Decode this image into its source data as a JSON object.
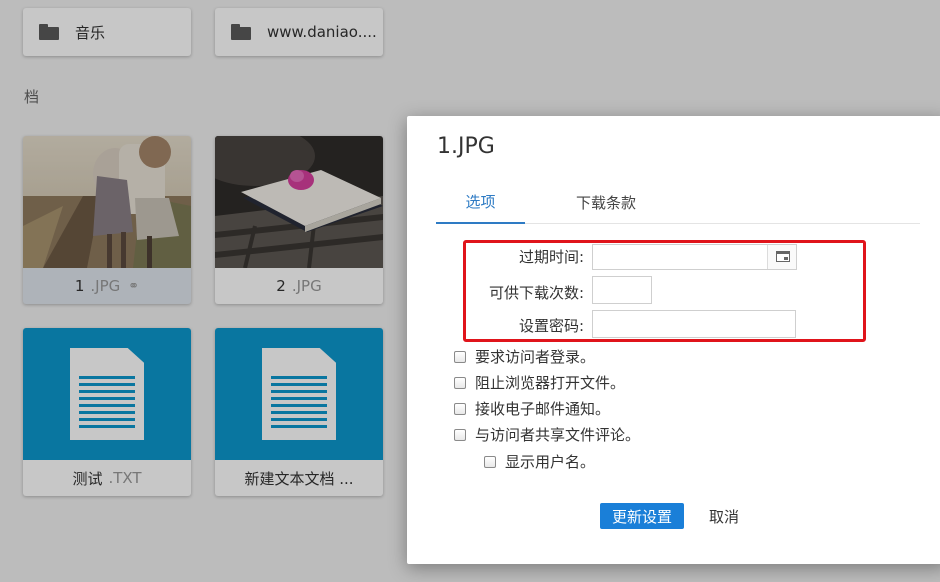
{
  "folders": [
    {
      "name": "音乐",
      "icon": "folder-icon"
    },
    {
      "name": "www.daniao....",
      "icon": "folder-icon"
    }
  ],
  "section_label": "档",
  "files": [
    {
      "name": "1",
      "ext": ".JPG",
      "link_glyph": "⚭"
    },
    {
      "name": "2",
      "ext": ".JPG"
    },
    {
      "name": "测试",
      "ext": ".TXT"
    },
    {
      "name": "新建文本文档 ..."
    }
  ],
  "dialog": {
    "title": "1.JPG",
    "tabs": [
      {
        "label": "选项",
        "active": true
      },
      {
        "label": "下载条款",
        "active": false
      }
    ],
    "fields": {
      "expiry": {
        "label": "过期时间:",
        "value": "",
        "icon": "calendar-icon"
      },
      "download_count": {
        "label": "可供下载次数:",
        "value": ""
      },
      "password": {
        "label": "设置密码:",
        "value": ""
      }
    },
    "checkboxes": [
      {
        "label": "要求访问者登录。",
        "checked": false
      },
      {
        "label": "阻止浏览器打开文件。",
        "checked": false
      },
      {
        "label": "接收电子邮件通知。",
        "checked": false
      },
      {
        "label": "与访问者共享文件评论。",
        "checked": false
      },
      {
        "label": "显示用户名。",
        "checked": false
      }
    ],
    "buttons": {
      "update": "更新设置",
      "cancel": "取消"
    }
  },
  "colors": {
    "accent": "#2e7bc4",
    "primary_button": "#1a7fd8",
    "highlight_box": "#e0141b",
    "doc_thumb": "#0c98cd"
  }
}
